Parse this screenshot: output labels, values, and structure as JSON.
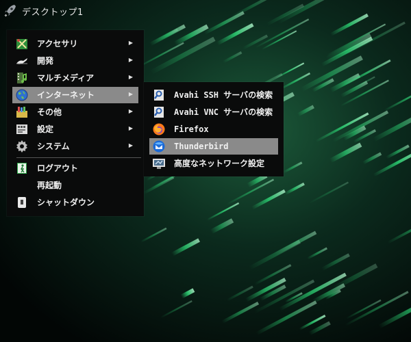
{
  "panel": {
    "title": "デスクトップ1",
    "launcher_icon": "rocket-icon"
  },
  "main_menu": {
    "items": [
      {
        "label": "アクセサリ",
        "icon": "accessories-icon",
        "has_submenu": true
      },
      {
        "label": "開発",
        "icon": "development-icon",
        "has_submenu": true
      },
      {
        "label": "マルチメディア",
        "icon": "multimedia-icon",
        "has_submenu": true
      },
      {
        "label": "インターネット",
        "icon": "internet-globe-icon",
        "has_submenu": true,
        "active": true
      },
      {
        "label": "その他",
        "icon": "other-icon",
        "has_submenu": true
      },
      {
        "label": "設定",
        "icon": "settings-icon",
        "has_submenu": true
      },
      {
        "label": "システム",
        "icon": "system-gear-icon",
        "has_submenu": true
      }
    ],
    "session_items": [
      {
        "label": "ログアウト",
        "icon": "logout-icon"
      },
      {
        "label": "再起動",
        "icon": ""
      },
      {
        "label": "シャットダウン",
        "icon": "shutdown-icon"
      }
    ],
    "arrow": "▶"
  },
  "internet_submenu": {
    "items": [
      {
        "label": "Avahi SSH サーバの検索",
        "icon": "avahi-ssh-icon"
      },
      {
        "label": "Avahi VNC サーバの検索",
        "icon": "avahi-vnc-icon"
      },
      {
        "label": "Firefox",
        "icon": "firefox-icon"
      },
      {
        "label": "Thunderbird",
        "icon": "thunderbird-icon",
        "active": true
      },
      {
        "label": "高度なネットワーク設定",
        "icon": "network-settings-icon"
      }
    ]
  },
  "colors": {
    "menu_bg": "#0a0b0b",
    "highlight": "#8a8a8a",
    "wallpaper_green": "#1fbf5a"
  }
}
